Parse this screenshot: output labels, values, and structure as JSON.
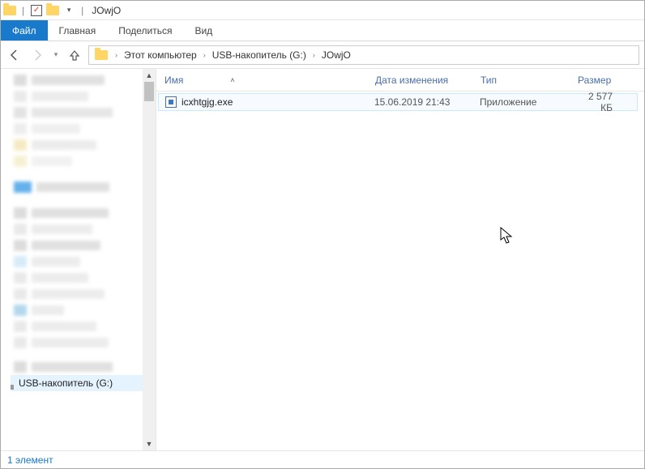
{
  "window": {
    "title": "JOwjO"
  },
  "ribbon": {
    "file": "Файл",
    "home": "Главная",
    "share": "Поделиться",
    "view": "Вид"
  },
  "breadcrumb": {
    "pc": "Этот компьютер",
    "drive": "USB-накопитель (G:)",
    "folder": "JOwjO"
  },
  "columns": {
    "name": "Имя",
    "date": "Дата изменения",
    "type": "Тип",
    "size": "Размер"
  },
  "files": [
    {
      "name": "icxhtgjg.exe",
      "date": "15.06.2019 21:43",
      "type": "Приложение",
      "size": "2 577 КБ"
    }
  ],
  "sidebar": {
    "selected_drive": "USB-накопитель (G:)"
  },
  "status": {
    "count": "1 элемент"
  }
}
